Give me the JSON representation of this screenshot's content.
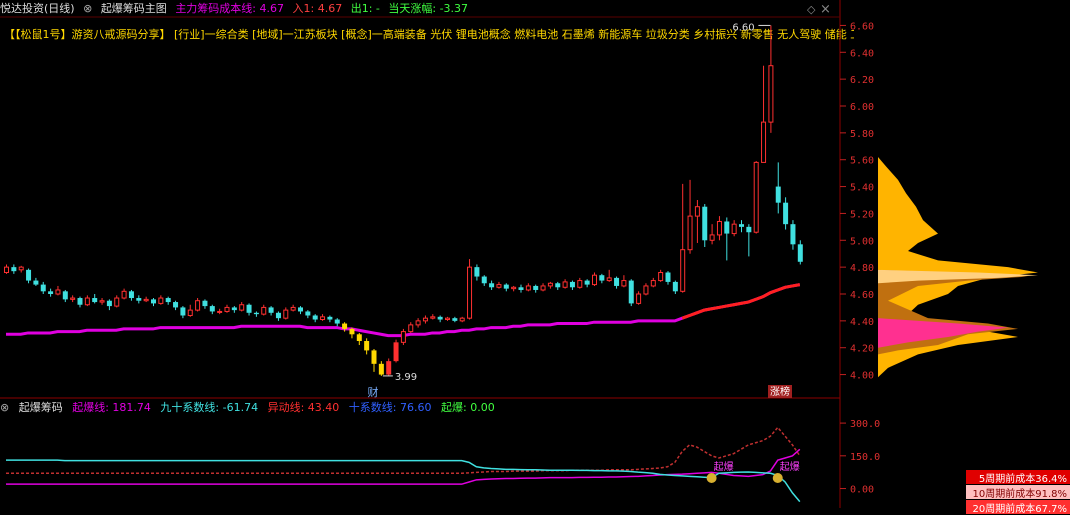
{
  "header": {
    "stock": "悦达投资(日线)",
    "indicator": "起爆筹码主图",
    "cost_label": "主力筹码成本线: 4.67",
    "in_label": "入1: 4.67",
    "out_label": "出1: -",
    "change_label": "当天涨幅: -3.37"
  },
  "info_line": "【【松鼠1号】游资八戒源码分享】 [行业]一综合类 [地域]一江苏板块 [概念]一高端装备 光伏 锂电池概念 燃料电池 石墨烯 新能源车 垃圾分类 乡村振兴 新零售 无人驾驶 储能 工业母机 乡",
  "window_controls": {
    "restore": "◇",
    "close": "×"
  },
  "annotations": {
    "high": "6.60",
    "low": "3.99",
    "cai": "财",
    "zhangbang": "涨榜",
    "qibao1": "起爆",
    "qibao2": "起爆"
  },
  "subchart": {
    "title": "起爆筹码",
    "line1": "起爆线: 181.74",
    "line2": "九十系数线: -61.74",
    "line3": "异动线: 43.40",
    "line4": "十系数线: 76.60",
    "line5": "起爆: 0.00"
  },
  "chip_legend": {
    "l1": "5周期前成本36.4%",
    "l2": "10周期前成本91.8%",
    "l3": "20周期前成本67.7%"
  },
  "colors": {
    "up": "#ff3030",
    "down": "#40e0e0",
    "cost_line": "#e000e0",
    "cost_red": "#ff2020",
    "yellow": "#ffd800",
    "chip_orange": "#ffb400"
  },
  "chart_data": {
    "type": "candlestick",
    "ylim": [
      3.9,
      6.7
    ],
    "yticks": [
      4.0,
      4.2,
      4.4,
      4.6,
      4.8,
      5.0,
      5.2,
      5.4,
      5.6,
      5.8,
      6.0,
      6.2,
      6.4,
      6.6
    ],
    "candles": [
      [
        4.76,
        4.8,
        4.82,
        4.75
      ],
      [
        4.8,
        4.77,
        4.82,
        4.75
      ],
      [
        4.78,
        4.8,
        4.81,
        4.76
      ],
      [
        4.78,
        4.7,
        4.79,
        4.68
      ],
      [
        4.7,
        4.67,
        4.72,
        4.66
      ],
      [
        4.67,
        4.62,
        4.69,
        4.6
      ],
      [
        4.62,
        4.6,
        4.64,
        4.58
      ],
      [
        4.6,
        4.63,
        4.66,
        4.59
      ],
      [
        4.62,
        4.56,
        4.63,
        4.54
      ],
      [
        4.56,
        4.57,
        4.59,
        4.54
      ],
      [
        4.57,
        4.52,
        4.58,
        4.5
      ],
      [
        4.52,
        4.57,
        4.59,
        4.51
      ],
      [
        4.57,
        4.54,
        4.6,
        4.53
      ],
      [
        4.54,
        4.55,
        4.57,
        4.52
      ],
      [
        4.55,
        4.51,
        4.56,
        4.48
      ],
      [
        4.51,
        4.57,
        4.59,
        4.5
      ],
      [
        4.57,
        4.62,
        4.64,
        4.56
      ],
      [
        4.62,
        4.57,
        4.63,
        4.55
      ],
      [
        4.57,
        4.55,
        4.59,
        4.53
      ],
      [
        4.55,
        4.56,
        4.58,
        4.54
      ],
      [
        4.56,
        4.53,
        4.57,
        4.51
      ],
      [
        4.53,
        4.57,
        4.59,
        4.52
      ],
      [
        4.57,
        4.54,
        4.58,
        4.52
      ],
      [
        4.54,
        4.5,
        4.55,
        4.48
      ],
      [
        4.5,
        4.44,
        4.51,
        4.42
      ],
      [
        4.44,
        4.48,
        4.52,
        4.43
      ],
      [
        4.48,
        4.55,
        4.57,
        4.47
      ],
      [
        4.55,
        4.51,
        4.56,
        4.49
      ],
      [
        4.51,
        4.47,
        4.52,
        4.45
      ],
      [
        4.47,
        4.47,
        4.49,
        4.45
      ],
      [
        4.47,
        4.5,
        4.52,
        4.46
      ],
      [
        4.5,
        4.48,
        4.51,
        4.46
      ],
      [
        4.48,
        4.52,
        4.54,
        4.47
      ],
      [
        4.52,
        4.46,
        4.53,
        4.44
      ],
      [
        4.46,
        4.45,
        4.47,
        4.43
      ],
      [
        4.45,
        4.5,
        4.52,
        4.44
      ],
      [
        4.5,
        4.46,
        4.51,
        4.44
      ],
      [
        4.46,
        4.42,
        4.47,
        4.4
      ],
      [
        4.42,
        4.48,
        4.5,
        4.41
      ],
      [
        4.48,
        4.5,
        4.52,
        4.47
      ],
      [
        4.5,
        4.47,
        4.51,
        4.45
      ],
      [
        4.47,
        4.44,
        4.48,
        4.42
      ],
      [
        4.44,
        4.41,
        4.45,
        4.39
      ],
      [
        4.41,
        4.43,
        4.45,
        4.4
      ],
      [
        4.43,
        4.41,
        4.44,
        4.39
      ],
      [
        4.41,
        4.38,
        4.42,
        4.36
      ],
      [
        4.38,
        4.34,
        4.39,
        4.32
      ],
      [
        4.34,
        4.3,
        4.35,
        4.27
      ],
      [
        4.3,
        4.25,
        4.31,
        4.22
      ],
      [
        4.25,
        4.18,
        4.27,
        4.15
      ],
      [
        4.18,
        4.08,
        4.19,
        4.02
      ],
      [
        4.08,
        4.0,
        4.1,
        3.99
      ],
      [
        4.0,
        4.1,
        4.12,
        3.99
      ],
      [
        4.1,
        4.24,
        4.26,
        4.09
      ],
      [
        4.24,
        4.32,
        4.34,
        4.22
      ],
      [
        4.32,
        4.37,
        4.39,
        4.31
      ],
      [
        4.37,
        4.4,
        4.42,
        4.35
      ],
      [
        4.4,
        4.42,
        4.44,
        4.38
      ],
      [
        4.42,
        4.43,
        4.45,
        4.41
      ],
      [
        4.43,
        4.41,
        4.44,
        4.39
      ],
      [
        4.41,
        4.42,
        4.43,
        4.4
      ],
      [
        4.42,
        4.4,
        4.43,
        4.39
      ],
      [
        4.4,
        4.42,
        4.43,
        4.39
      ],
      [
        4.42,
        4.8,
        4.86,
        4.41
      ],
      [
        4.8,
        4.73,
        4.82,
        4.7
      ],
      [
        4.73,
        4.68,
        4.74,
        4.66
      ],
      [
        4.68,
        4.65,
        4.7,
        4.63
      ],
      [
        4.65,
        4.67,
        4.69,
        4.64
      ],
      [
        4.67,
        4.64,
        4.68,
        4.62
      ],
      [
        4.64,
        4.65,
        4.66,
        4.62
      ],
      [
        4.65,
        4.63,
        4.67,
        4.61
      ],
      [
        4.63,
        4.66,
        4.68,
        4.62
      ],
      [
        4.66,
        4.63,
        4.67,
        4.61
      ],
      [
        4.63,
        4.66,
        4.68,
        4.62
      ],
      [
        4.66,
        4.68,
        4.69,
        4.64
      ],
      [
        4.68,
        4.65,
        4.69,
        4.63
      ],
      [
        4.65,
        4.69,
        4.71,
        4.64
      ],
      [
        4.69,
        4.65,
        4.7,
        4.63
      ],
      [
        4.65,
        4.7,
        4.72,
        4.64
      ],
      [
        4.7,
        4.67,
        4.71,
        4.65
      ],
      [
        4.67,
        4.74,
        4.76,
        4.66
      ],
      [
        4.74,
        4.7,
        4.75,
        4.68
      ],
      [
        4.7,
        4.72,
        4.78,
        4.69
      ],
      [
        4.72,
        4.66,
        4.73,
        4.64
      ],
      [
        4.66,
        4.7,
        4.74,
        4.65
      ],
      [
        4.7,
        4.53,
        4.71,
        4.51
      ],
      [
        4.53,
        4.6,
        4.62,
        4.52
      ],
      [
        4.6,
        4.66,
        4.68,
        4.59
      ],
      [
        4.66,
        4.7,
        4.72,
        4.65
      ],
      [
        4.7,
        4.76,
        4.78,
        4.69
      ],
      [
        4.76,
        4.69,
        4.77,
        4.67
      ],
      [
        4.69,
        4.62,
        4.7,
        4.6
      ],
      [
        4.62,
        4.93,
        5.42,
        4.61
      ],
      [
        4.93,
        5.18,
        5.45,
        4.9
      ],
      [
        5.18,
        5.25,
        5.3,
        4.98
      ],
      [
        5.25,
        5.0,
        5.27,
        4.95
      ],
      [
        5.0,
        5.04,
        5.12,
        4.97
      ],
      [
        5.04,
        5.14,
        5.18,
        5.0
      ],
      [
        5.14,
        5.05,
        5.17,
        4.85
      ],
      [
        5.05,
        5.12,
        5.15,
        5.03
      ],
      [
        5.12,
        5.1,
        5.15,
        5.06
      ],
      [
        5.1,
        5.06,
        5.12,
        4.88
      ],
      [
        5.06,
        5.58,
        5.59,
        5.05
      ],
      [
        5.58,
        5.88,
        6.3,
        5.82
      ],
      [
        5.88,
        6.3,
        6.6,
        5.8
      ],
      [
        5.4,
        5.28,
        5.58,
        5.2
      ],
      [
        5.28,
        5.12,
        5.32,
        5.08
      ],
      [
        5.12,
        4.97,
        5.15,
        4.93
      ],
      [
        4.97,
        4.84,
        5.0,
        4.82
      ]
    ],
    "cost_line": [
      4.3,
      4.3,
      4.3,
      4.31,
      4.31,
      4.31,
      4.31,
      4.32,
      4.32,
      4.32,
      4.32,
      4.33,
      4.33,
      4.33,
      4.33,
      4.33,
      4.34,
      4.34,
      4.34,
      4.34,
      4.34,
      4.35,
      4.35,
      4.35,
      4.35,
      4.35,
      4.35,
      4.35,
      4.35,
      4.35,
      4.35,
      4.35,
      4.36,
      4.36,
      4.36,
      4.36,
      4.36,
      4.36,
      4.36,
      4.36,
      4.36,
      4.35,
      4.35,
      4.35,
      4.35,
      4.35,
      4.34,
      4.34,
      4.33,
      4.32,
      4.31,
      4.3,
      4.29,
      4.29,
      4.29,
      4.3,
      4.3,
      4.3,
      4.31,
      4.31,
      4.32,
      4.32,
      4.33,
      4.33,
      4.34,
      4.34,
      4.35,
      4.35,
      4.35,
      4.36,
      4.36,
      4.37,
      4.37,
      4.37,
      4.37,
      4.38,
      4.38,
      4.38,
      4.38,
      4.38,
      4.39,
      4.39,
      4.39,
      4.39,
      4.39,
      4.39,
      4.4,
      4.4,
      4.4,
      4.4,
      4.4,
      4.4,
      4.42,
      4.44,
      4.46,
      4.48,
      4.49,
      4.5,
      4.51,
      4.52,
      4.53,
      4.54,
      4.56,
      4.58,
      4.61,
      4.63,
      4.65,
      4.66,
      4.67
    ],
    "sub_ylim": [
      -80,
      360
    ],
    "sub_yticks": [
      0,
      150,
      300
    ],
    "sub_tick_labels": [
      "0.00",
      "150.0",
      "300.0"
    ],
    "sub_cyan": [
      130,
      130,
      130,
      130,
      130,
      130,
      130,
      130,
      128,
      128,
      128,
      128,
      128,
      128,
      128,
      128,
      128,
      128,
      128,
      128,
      128,
      128,
      128,
      128,
      128,
      128,
      128,
      128,
      128,
      128,
      128,
      128,
      128,
      128,
      128,
      128,
      128,
      128,
      128,
      128,
      128,
      128,
      128,
      128,
      128,
      128,
      128,
      128,
      128,
      128,
      128,
      128,
      128,
      128,
      128,
      128,
      128,
      128,
      128,
      128,
      128,
      128,
      128,
      120,
      100,
      95,
      92,
      90,
      88,
      88,
      87,
      86,
      86,
      85,
      84,
      84,
      84,
      84,
      83,
      83,
      82,
      82,
      81,
      81,
      80,
      78,
      75,
      73,
      70,
      65,
      62,
      60,
      58,
      56,
      54,
      52,
      50,
      70,
      72,
      74,
      75,
      76,
      74,
      72,
      70,
      60,
      30,
      -20,
      -60
    ],
    "sub_magenta": [
      20,
      20,
      20,
      20,
      20,
      20,
      20,
      20,
      20,
      20,
      20,
      20,
      20,
      20,
      20,
      20,
      20,
      20,
      20,
      20,
      20,
      20,
      20,
      20,
      20,
      20,
      20,
      20,
      20,
      20,
      20,
      20,
      20,
      20,
      20,
      20,
      20,
      20,
      20,
      20,
      20,
      20,
      20,
      20,
      20,
      20,
      20,
      20,
      20,
      20,
      20,
      20,
      20,
      20,
      20,
      20,
      20,
      20,
      20,
      20,
      20,
      20,
      20,
      30,
      40,
      42,
      44,
      45,
      46,
      46,
      47,
      48,
      48,
      49,
      50,
      50,
      50,
      50,
      51,
      51,
      52,
      52,
      53,
      53,
      54,
      55,
      56,
      58,
      60,
      62,
      64,
      65,
      66,
      68,
      70,
      72,
      74,
      70,
      65,
      60,
      58,
      56,
      60,
      64,
      80,
      130,
      140,
      150,
      180
    ],
    "sub_dashed": [
      70,
      70,
      70,
      70,
      70,
      70,
      70,
      70,
      70,
      70,
      70,
      70,
      70,
      70,
      70,
      70,
      70,
      70,
      70,
      70,
      70,
      70,
      70,
      70,
      70,
      70,
      70,
      70,
      70,
      70,
      70,
      70,
      70,
      70,
      70,
      70,
      70,
      70,
      70,
      70,
      70,
      70,
      70,
      70,
      70,
      70,
      70,
      70,
      70,
      70,
      70,
      70,
      70,
      70,
      70,
      70,
      70,
      70,
      70,
      70,
      70,
      70,
      70,
      72,
      74,
      76,
      78,
      78,
      78,
      80,
      80,
      80,
      80,
      82,
      82,
      82,
      82,
      84,
      84,
      84,
      84,
      84,
      86,
      86,
      86,
      86,
      88,
      90,
      92,
      94,
      100,
      120,
      170,
      200,
      190,
      170,
      150,
      140,
      150,
      160,
      180,
      200,
      210,
      220,
      240,
      280,
      240,
      200,
      150
    ]
  }
}
